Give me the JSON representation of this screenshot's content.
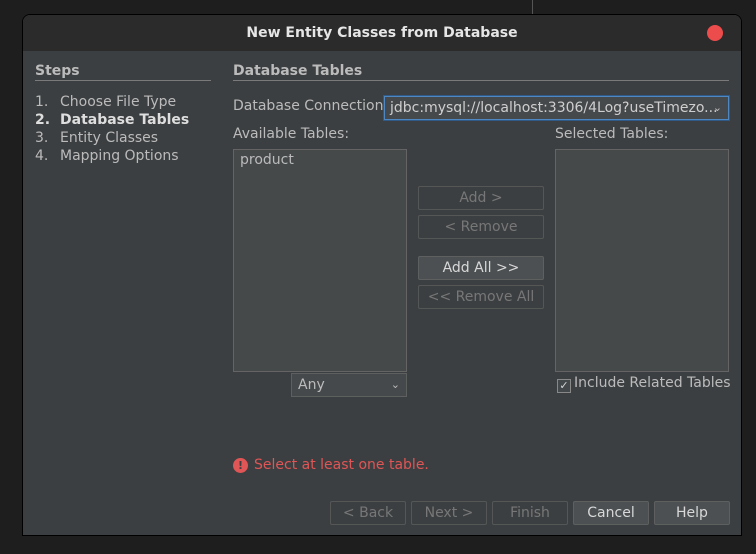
{
  "dialog": {
    "title": "New Entity Classes from Database"
  },
  "steps": {
    "heading": "Steps",
    "items": [
      {
        "num": "1.",
        "label": "Choose File Type"
      },
      {
        "num": "2.",
        "label": "Database Tables"
      },
      {
        "num": "3.",
        "label": "Entity Classes"
      },
      {
        "num": "4.",
        "label": "Mapping Options"
      }
    ]
  },
  "panel": {
    "heading": "Database Tables",
    "connection_label": "Database Connection:",
    "connection_value": "jdbc:mysql://localhost:3306/4Log?useTimezo...",
    "available_label": "Available Tables:",
    "selected_label": "Selected Tables:",
    "available_tables": [
      "product"
    ],
    "filter_value": "Any",
    "include_related_label": "Include Related Tables",
    "include_related_checked": true,
    "error_message": "Select at least one table."
  },
  "transfer_buttons": {
    "add": "Add >",
    "remove": "< Remove",
    "add_all": "Add All >>",
    "remove_all": "<< Remove All"
  },
  "footer_buttons": {
    "back": "< Back",
    "next": "Next >",
    "finish": "Finish",
    "cancel": "Cancel",
    "help": "Help"
  },
  "colors": {
    "dialog_bg": "#3c3f41",
    "titlebar_bg": "#2b2b2b",
    "close_button": "#ed4c4c",
    "error": "#e05555",
    "focus": "#4e87c2"
  }
}
